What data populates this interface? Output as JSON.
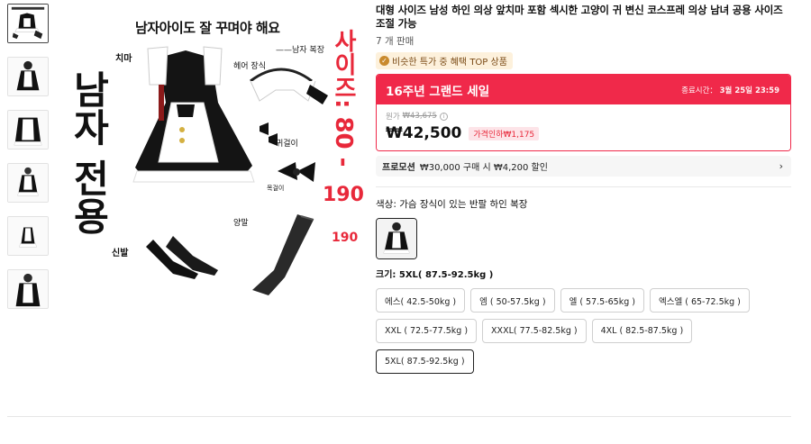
{
  "gallery": {
    "thumbnails": [
      {
        "name": "thumb-1",
        "active": true
      },
      {
        "name": "thumb-2",
        "active": false
      },
      {
        "name": "thumb-3",
        "active": false
      },
      {
        "name": "thumb-4",
        "active": false
      },
      {
        "name": "thumb-5",
        "active": false
      },
      {
        "name": "thumb-6",
        "active": false
      }
    ],
    "main_image": {
      "headline": "남자아이도 잘 꾸며야 해요",
      "subcaption": "——남자 복장",
      "vertical_text": "남자 전용",
      "red_vertical_text": "사이즈: 80 -",
      "red_190_large": "190",
      "red_190_small": "190",
      "labels": {
        "skirt": "치마",
        "hair": "헤어 장식",
        "earring": "귀걸이",
        "necklace": "목걸이",
        "shoes": "신발",
        "socks": "양말"
      }
    }
  },
  "product": {
    "title": "대형 사이즈 남성 하인 의상 앞치마 포함 섹시한 고양이 귀 변신 코스프레 의상 남녀 공용 사이즈 조절 가능",
    "sold": "7 개 판매",
    "badge": "비슷한 특가 중 혜택 TOP 상품"
  },
  "sale": {
    "title": "16주년 그랜드 세일",
    "end_label": "종료시간：",
    "end_time": "3월 25일 23:59",
    "original_label": "원가",
    "original_price": "₩43,675",
    "price": "₩42,500",
    "price_drop": "가격인하₩1,175"
  },
  "promo": {
    "label": "프로모션",
    "text": "₩30,000 구매 시 ₩4,200 할인"
  },
  "color": {
    "label": "색상: 가슴 장식이 있는 반팔 하인 복장"
  },
  "size": {
    "label": "크기: 5XL( 87.5-92.5kg )",
    "options": [
      {
        "label": "에스( 42.5-50kg )",
        "selected": false
      },
      {
        "label": "엠 ( 50-57.5kg )",
        "selected": false
      },
      {
        "label": "엘 ( 57.5-65kg )",
        "selected": false
      },
      {
        "label": "엑스엘 ( 65-72.5kg )",
        "selected": false
      },
      {
        "label": "XXL ( 72.5-77.5kg )",
        "selected": false
      },
      {
        "label": "XXXL( 77.5-82.5kg )",
        "selected": false
      },
      {
        "label": "4XL ( 82.5-87.5kg )",
        "selected": false
      },
      {
        "label": "5XL( 87.5-92.5kg )",
        "selected": true
      }
    ]
  },
  "colors": {
    "accent": "#f0294a",
    "badge_bg": "#fdf1dc",
    "drop_bg": "#fde4e8"
  }
}
